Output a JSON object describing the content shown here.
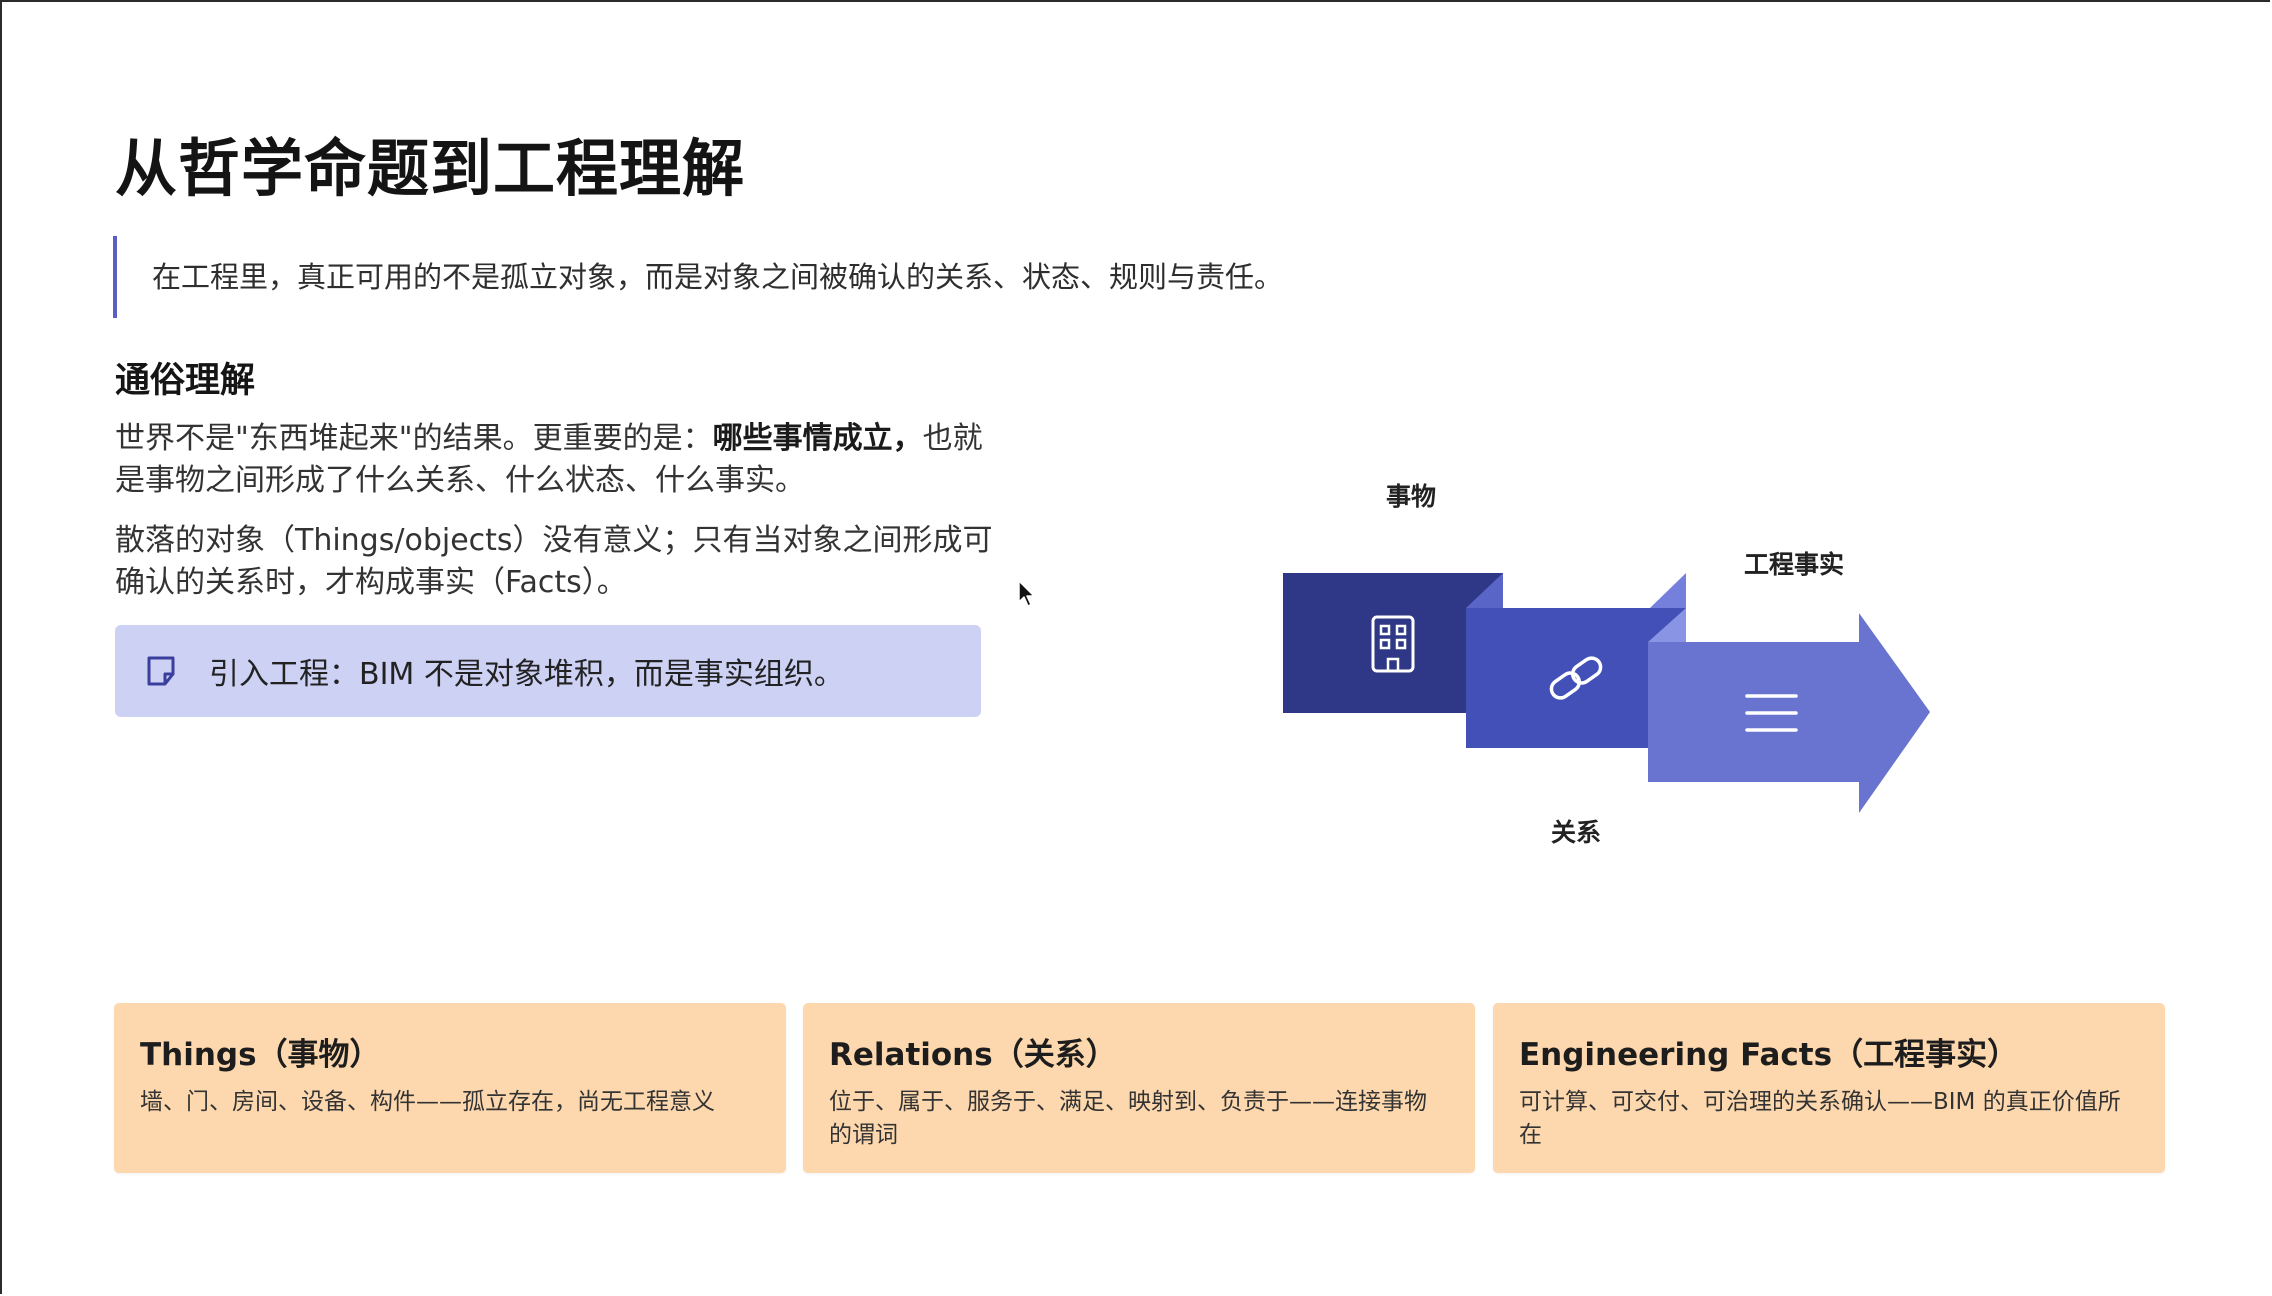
{
  "slide": {
    "title": "从哲学命题到工程理解",
    "quote": "在工程里，真正可用的不是孤立对象，而是对象之间被确认的关系、状态、规则与责任。",
    "section_title": "通俗理解",
    "para1": {
      "before": "世界不是\"东西堆起来\"的结果。更重要的是：",
      "bold": "哪些事情成立，",
      "after": "也就是事物之间形成了什么关系、什么状态、什么事实。"
    },
    "para2": "散落的对象（Things/objects）没有意义；只有当对象之间形成可确认的关系时，才构成事实（Facts）。",
    "callout": {
      "icon": "note-icon",
      "text": "引入工程：BIM 不是对象堆积，而是事实组织。"
    }
  },
  "diagram": {
    "labels": {
      "things": "事物",
      "relations": "关系",
      "facts": "工程事实"
    },
    "icons": [
      "building-icon",
      "link-icon",
      "list-icon"
    ],
    "colors": {
      "things": "#2e3886",
      "relations": "#4250b8",
      "facts": "#6874d0"
    }
  },
  "cards": [
    {
      "title": "Things（事物）",
      "desc": "墙、门、房间、设备、构件——孤立存在，尚无工程意义"
    },
    {
      "title": "Relations（关系）",
      "desc": "位于、属于、服务于、满足、映射到、负责于——连接事物的谓词"
    },
    {
      "title": "Engineering Facts（工程事实）",
      "desc": "可计算、可交付、可治理的关系确认——BIM 的真正价值所在"
    }
  ],
  "colors": {
    "accent": "#5a5fc8",
    "callout_bg": "#cdd1f4",
    "card_bg": "#fdd8ae"
  }
}
